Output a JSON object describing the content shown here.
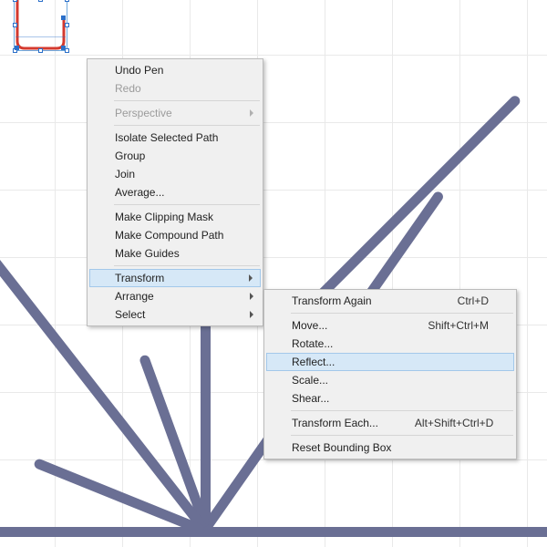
{
  "contextmenu": {
    "undo": "Undo Pen",
    "redo": "Redo",
    "perspective": "Perspective",
    "isolate": "Isolate Selected Path",
    "group": "Group",
    "join": "Join",
    "average": "Average...",
    "clipping": "Make Clipping Mask",
    "compound": "Make Compound Path",
    "guides": "Make Guides",
    "transform": "Transform",
    "arrange": "Arrange",
    "select": "Select"
  },
  "transform_submenu": {
    "again": {
      "label": "Transform Again",
      "shortcut": "Ctrl+D"
    },
    "move": {
      "label": "Move...",
      "shortcut": "Shift+Ctrl+M"
    },
    "rotate": {
      "label": "Rotate..."
    },
    "reflect": {
      "label": "Reflect..."
    },
    "scale": {
      "label": "Scale..."
    },
    "shear": {
      "label": "Shear..."
    },
    "each": {
      "label": "Transform Each...",
      "shortcut": "Alt+Shift+Ctrl+D"
    },
    "reset": {
      "label": "Reset Bounding Box"
    }
  },
  "chart_data": null
}
